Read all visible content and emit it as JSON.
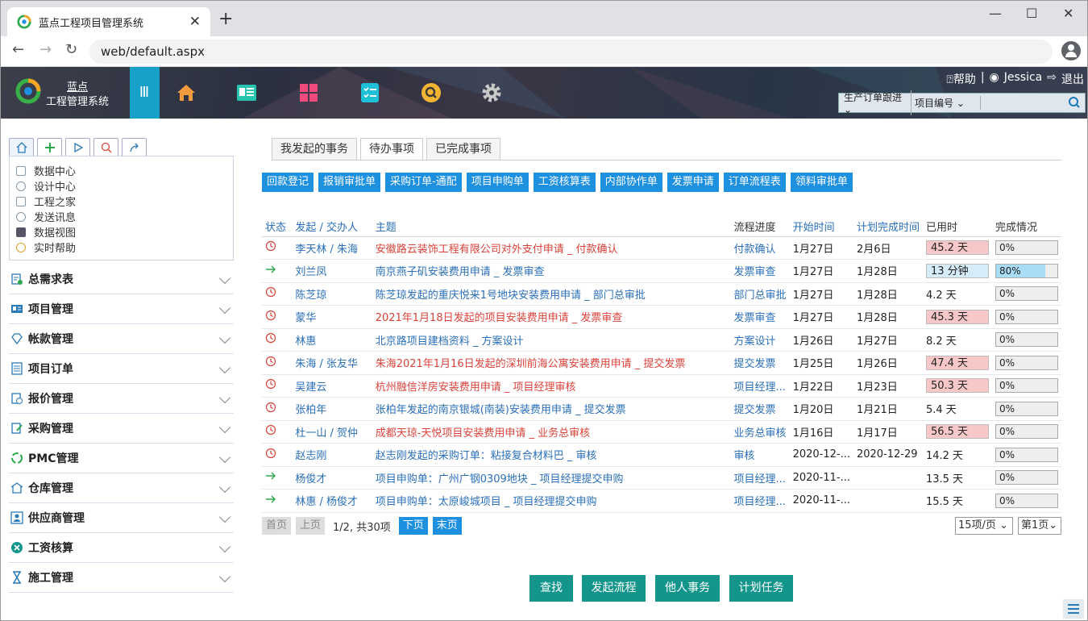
{
  "browser": {
    "tab_title": "蓝点工程项目管理系统",
    "tab_close": "✕",
    "new_tab": "+",
    "url": "web/default.aspx",
    "controls": {
      "minimize": "—",
      "maximize": "☐",
      "close": "✕"
    }
  },
  "header": {
    "logo_line1": "蓝点",
    "logo_line2": "工程管理系统",
    "menu_toggle": "Ⅲ",
    "help": "⍰帮助",
    "separator": "|",
    "user": "Jessica",
    "logout": "退出",
    "search": {
      "type_select": "生产订单跟进",
      "field_select": "项目编号"
    }
  },
  "sidebar": {
    "quick_links": [
      "数据中心",
      "设计中心",
      "工程之家",
      "发送讯息",
      "数据视图",
      "实时帮助"
    ],
    "menus": [
      "总需求表",
      "项目管理",
      "帐款管理",
      "项目订单",
      "报价管理",
      "采购管理",
      "PMC管理",
      "仓库管理",
      "供应商管理",
      "工资核算",
      "施工管理"
    ]
  },
  "main": {
    "tabs": [
      "我发起的事务",
      "待办事项",
      "已完成事项"
    ],
    "active_tab": "待办事项",
    "quick_buttons": [
      "回款登记",
      "报销审批单",
      "采购订单-通配",
      "项目申购单",
      "工资核算表",
      "内部协作单",
      "发票申请",
      "订单流程表",
      "领料审批单"
    ],
    "columns": [
      "状态",
      "发起",
      "交办人",
      "主题",
      "流程进度",
      "开始时间",
      "计划完成时间",
      "已用时",
      "完成情况"
    ],
    "rows": [
      {
        "status": "clock",
        "who": "李天林",
        "delegate": "朱海",
        "subject": "安徽路云装饰工程有限公司对外支付申请 _ 付款确认",
        "red": true,
        "progress": "付款确认",
        "start": "1月27日",
        "plan": "2月6日",
        "used": "45.2 天",
        "used_style": "red",
        "done": "0%",
        "done_pct": 0
      },
      {
        "status": "arrow",
        "who": "刘兰凤",
        "delegate": "",
        "subject": "南京燕子矶安装费用申请 _ 发票审查",
        "red": false,
        "progress": "发票审查",
        "start": "1月27日",
        "plan": "1月28日",
        "used": "13 分钟",
        "used_style": "blue",
        "done": "80%",
        "done_pct": 80
      },
      {
        "status": "clock",
        "who": "陈芝琼",
        "delegate": "",
        "subject": "陈芝琼发起的重庆悦来1号地块安装费用申请 _ 部门总审批",
        "red": false,
        "progress": "部门总审批",
        "start": "1月27日",
        "plan": "1月28日",
        "used": "4.2 天",
        "used_style": "",
        "done": "0%",
        "done_pct": 0
      },
      {
        "status": "clock",
        "who": "蒙华",
        "delegate": "",
        "subject": "2021年1月18日发起的项目安装费用申请 _ 发票审查",
        "red": true,
        "progress": "发票审查",
        "start": "1月27日",
        "plan": "1月28日",
        "used": "45.3 天",
        "used_style": "red",
        "done": "0%",
        "done_pct": 0
      },
      {
        "status": "clock",
        "who": "林惠",
        "delegate": "",
        "subject": "北京路项目建档资料 _ 方案设计",
        "red": false,
        "progress": "方案设计",
        "start": "1月26日",
        "plan": "1月27日",
        "used": "8.2 天",
        "used_style": "",
        "done": "0%",
        "done_pct": 0
      },
      {
        "status": "clock",
        "who": "朱海",
        "delegate": "张友华",
        "subject": "朱海2021年1月16日发起的深圳前海公寓安装费用申请 _ 提交发票",
        "red": true,
        "progress": "提交发票",
        "start": "1月25日",
        "plan": "1月26日",
        "used": "47.4 天",
        "used_style": "red",
        "done": "0%",
        "done_pct": 0
      },
      {
        "status": "clock",
        "who": "吴建云",
        "delegate": "",
        "subject": "杭州融信洋房安装费用申请 _ 项目经理审核",
        "red": true,
        "progress": "项目经理...",
        "start": "1月22日",
        "plan": "1月23日",
        "used": "50.3 天",
        "used_style": "red",
        "done": "0%",
        "done_pct": 0
      },
      {
        "status": "clock",
        "who": "张柏年",
        "delegate": "",
        "subject": "张柏年发起的南京银城(南装)安装费用申请 _ 提交发票",
        "red": false,
        "progress": "提交发票",
        "start": "1月20日",
        "plan": "1月21日",
        "used": "5.4 天",
        "used_style": "",
        "done": "0%",
        "done_pct": 0
      },
      {
        "status": "clock",
        "who": "杜一山",
        "delegate": "贺仲",
        "subject": "成都天琼-天悦项目安装费用申请 _ 业务总审核",
        "red": true,
        "progress": "业务总审核",
        "start": "1月16日",
        "plan": "1月17日",
        "used": "56.5 天",
        "used_style": "red",
        "done": "0%",
        "done_pct": 0
      },
      {
        "status": "clock",
        "who": "赵志刚",
        "delegate": "",
        "subject": "赵志刚发起的采购订单：粘接复合材料巴 _ 审核",
        "red": false,
        "progress": "审核",
        "start": "2020-12-...",
        "plan": "2020-12-29",
        "used": "14.2 天",
        "used_style": "",
        "done": "0%",
        "done_pct": 0
      },
      {
        "status": "arrow",
        "who": "杨俊才",
        "delegate": "",
        "subject": "项目申购单：广州广钢0309地块 _ 项目经理提交申购",
        "red": false,
        "progress": "项目经理...",
        "start": "2020-11-...",
        "plan": "",
        "used": "13.5 天",
        "used_style": "",
        "done": "0%",
        "done_pct": 0
      },
      {
        "status": "arrow",
        "who": "林惠",
        "delegate": "杨俊才",
        "subject": "项目申购单：太原峻城项目 _ 项目经理提交申购",
        "red": false,
        "progress": "项目经理...",
        "start": "2020-11-...",
        "plan": "",
        "used": "15.5 天",
        "used_style": "",
        "done": "0%",
        "done_pct": 0
      }
    ],
    "pager": {
      "first": "首页",
      "prev": "上页",
      "info": "1/2, 共30项",
      "next": "下页",
      "last": "末页",
      "page_size": "15项/页",
      "page_select": "第1页"
    },
    "bottom_buttons": [
      "查找",
      "发起流程",
      "他人事务",
      "计划任务"
    ]
  },
  "colors": {
    "accent": "#1e90e0",
    "teal": "#14958c",
    "menu_blue": "#17a0c8",
    "red_text": "#d9423a"
  }
}
